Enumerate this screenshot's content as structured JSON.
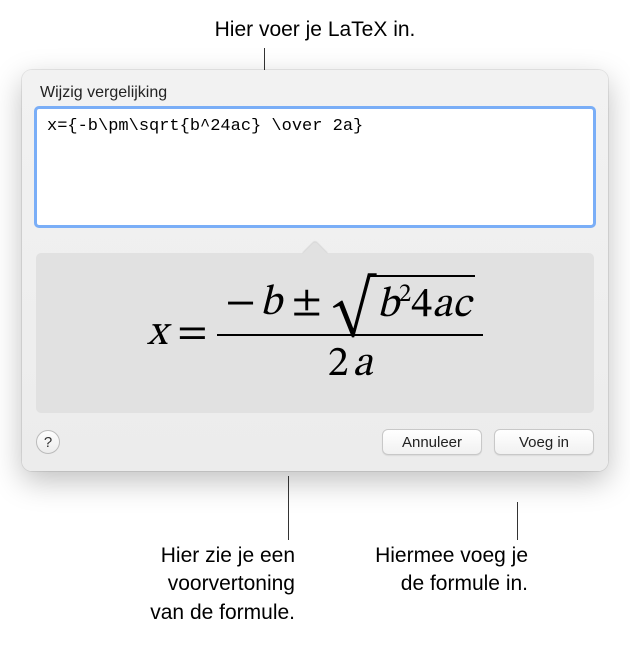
{
  "callouts": {
    "top": "Hier voer je LaTeX in.",
    "preview_l1": "Hier zie je een",
    "preview_l2": "voorvertoning",
    "preview_l3": "van de formule.",
    "insert_l1": "Hiermee voeg je",
    "insert_l2": "de formule in."
  },
  "dialog": {
    "title": "Wijzig vergelijking",
    "latex_value": "x={-b\\pm\\sqrt{b^24ac} \\over 2a}",
    "buttons": {
      "help": "?",
      "cancel": "Annuleer",
      "insert": "Voeg in"
    }
  },
  "colors": {
    "focus_ring": "#7aaef7",
    "preview_bg": "#e1e1e1"
  }
}
